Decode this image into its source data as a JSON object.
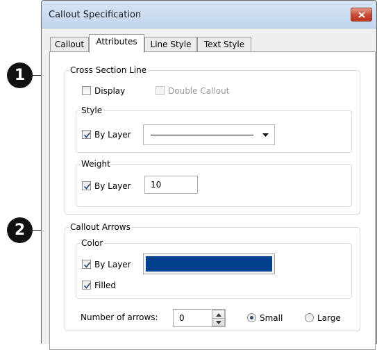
{
  "dialog": {
    "title": "Callout Specification"
  },
  "tabs": [
    {
      "label": "Callout",
      "active": false
    },
    {
      "label": "Attributes",
      "active": true
    },
    {
      "label": "Line Style",
      "active": false
    },
    {
      "label": "Text Style",
      "active": false
    }
  ],
  "markers": {
    "one": "1",
    "two": "2"
  },
  "cross_section": {
    "title": "Cross Section Line",
    "display_label": "Display",
    "display_checked": false,
    "double_callout_label": "Double Callout",
    "double_callout_enabled": false,
    "style": {
      "title": "Style",
      "by_layer_label": "By Layer",
      "by_layer_checked": true
    },
    "weight": {
      "title": "Weight",
      "by_layer_label": "By Layer",
      "by_layer_checked": true,
      "value": "10"
    }
  },
  "callout_arrows": {
    "title": "Callout Arrows",
    "color": {
      "title": "Color",
      "by_layer_label": "By Layer",
      "by_layer_checked": true,
      "swatch_color": "#003f8a"
    },
    "filled_label": "Filled",
    "filled_checked": true,
    "number_label": "Number of arrows:",
    "number_value": "0",
    "size_small_label": "Small",
    "size_large_label": "Large",
    "size_selected": "Small"
  }
}
